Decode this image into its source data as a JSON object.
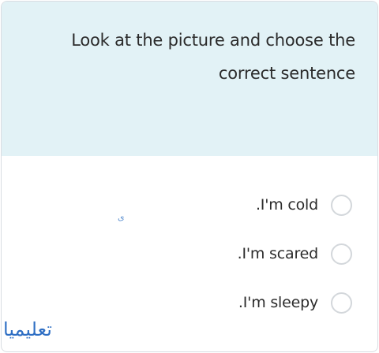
{
  "question": {
    "line1": "Look at the picture and choose the",
    "line2": "correct sentence"
  },
  "options": [
    {
      "label": ".I'm cold"
    },
    {
      "label": ".I'm scared"
    },
    {
      "label": ".I'm sleepy"
    }
  ],
  "small_mark": "ﻯ",
  "watermark": "تعليميا",
  "colors": {
    "header_bg": "#e2f2f6",
    "radio_border": "#d3d7db",
    "watermark": "#2f6fc4"
  }
}
